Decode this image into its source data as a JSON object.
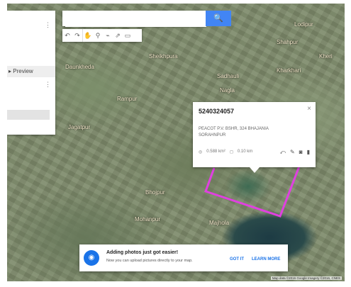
{
  "search": {
    "placeholder": "",
    "button_icon": "search-icon"
  },
  "toolbar": {
    "icons": [
      "undo-icon",
      "redo-icon",
      "hand-icon",
      "marker-icon",
      "line-icon",
      "route-icon",
      "ruler-icon"
    ]
  },
  "left_panel": {
    "preview_label": "Preview"
  },
  "map": {
    "places": [
      "Daunkheda",
      "Sheikhpura",
      "Nagla",
      "Jagatpur",
      "Rampur",
      "Kheri",
      "Shahpur",
      "Bhojpur",
      "Mohanpur",
      "Sadhauli",
      "Majhola",
      "Kharkhari",
      "Lodipur"
    ],
    "polygon_color": "#e040e0"
  },
  "info_card": {
    "title": "5240324057",
    "address_line1": "PEACOT P.V. BSHR, 324 BHAJANIA",
    "address_line2": "SORAHNPUR",
    "perimeter": "0.588 km²",
    "area": "0.10 km"
  },
  "banner": {
    "heading": "Adding photos just got easier!",
    "subtext": "Now you can upload pictures directly to your map.",
    "got_it": "GOT IT",
    "learn_more": "LEARN MORE"
  },
  "attribution": "Map data ©2016 Google Imagery ©2016, CNES"
}
